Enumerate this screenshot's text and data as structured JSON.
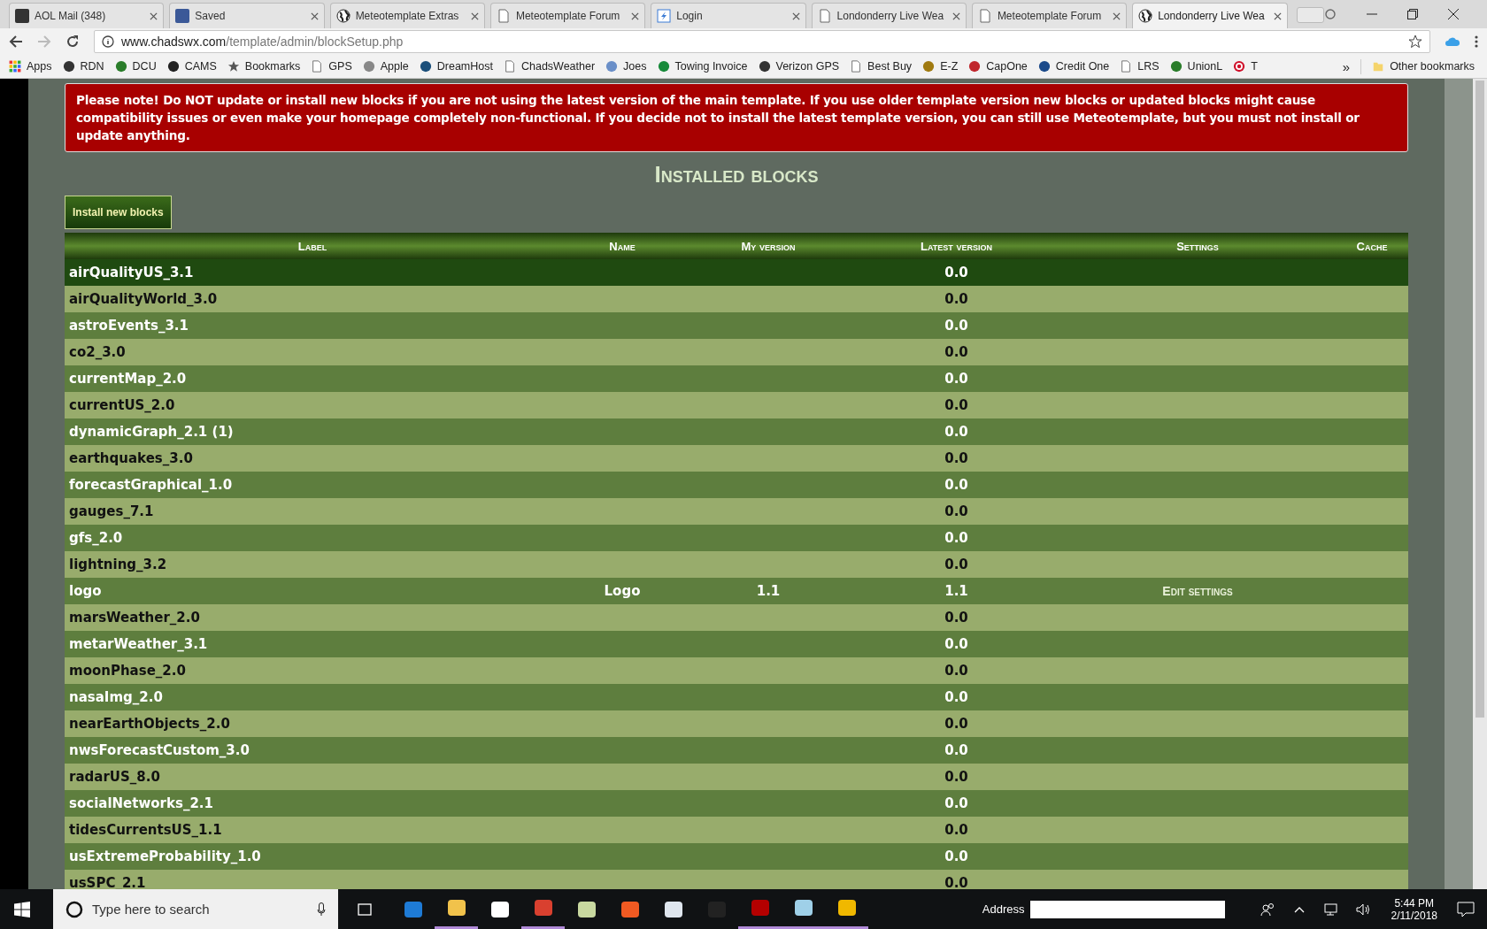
{
  "tabs": [
    {
      "title": "AOL Mail (348)",
      "kind": "aol",
      "selected": false
    },
    {
      "title": "Saved",
      "kind": "facebook",
      "selected": false
    },
    {
      "title": "Meteotemplate Extras",
      "kind": "globe",
      "selected": false
    },
    {
      "title": "Meteotemplate Forum",
      "kind": "page",
      "selected": false
    },
    {
      "title": "Login",
      "kind": "login",
      "selected": false
    },
    {
      "title": "Londonderry Live Wea",
      "kind": "page",
      "selected": false
    },
    {
      "title": "Meteotemplate Forum",
      "kind": "page",
      "selected": false
    },
    {
      "title": "Londonderry Live Wea",
      "kind": "globe",
      "selected": true
    }
  ],
  "address": {
    "host": "www.chadswx.com",
    "path": "/template/admin/blockSetup.php"
  },
  "bookmarks": [
    {
      "label": "Apps",
      "kind": "apps"
    },
    {
      "label": "RDN",
      "kind": "dark"
    },
    {
      "label": "DCU",
      "kind": "green"
    },
    {
      "label": "CAMS",
      "kind": "camera"
    },
    {
      "label": "Bookmarks",
      "kind": "star"
    },
    {
      "label": "GPS",
      "kind": "page"
    },
    {
      "label": "Apple",
      "kind": "apple"
    },
    {
      "label": "DreamHost",
      "kind": "moon"
    },
    {
      "label": "ChadsWeather",
      "kind": "page"
    },
    {
      "label": "Joes",
      "kind": "photo"
    },
    {
      "label": "Towing Invoice",
      "kind": "dollar"
    },
    {
      "label": "Verizon GPS",
      "kind": "dark"
    },
    {
      "label": "Best Buy",
      "kind": "page"
    },
    {
      "label": "E-Z",
      "kind": "badge"
    },
    {
      "label": "CapOne",
      "kind": "swoosh"
    },
    {
      "label": "Credit One",
      "kind": "blue"
    },
    {
      "label": "LRS",
      "kind": "page"
    },
    {
      "label": "UnionL",
      "kind": "green"
    },
    {
      "label": "T",
      "kind": "target"
    }
  ],
  "bookmarks_overflow": "»",
  "other_bookmarks": "Other bookmarks",
  "notice": "Please note! Do NOT update or install new blocks if you are not using the latest version of the main template. If you use older template version new blocks or updated blocks might cause compatibility issues or even make your homepage completely non-functional. If you decide not to install the latest template version, you can still use Meteotemplate, but you must not install or update anything.",
  "heading": "Installed blocks",
  "install_button": "Install new blocks",
  "table": {
    "columns": [
      "Label",
      "Name",
      "My version",
      "Latest version",
      "Settings",
      "Cache"
    ],
    "rows": [
      {
        "label": "airQualityUS_3.1",
        "latest": "0.0",
        "highlighted": true
      },
      {
        "label": "airQualityWorld_3.0",
        "latest": "0.0",
        "highlighted": false
      },
      {
        "label": "astroEvents_3.1",
        "latest": "0.0",
        "highlighted": false
      },
      {
        "label": "co2_3.0",
        "latest": "0.0",
        "highlighted": false
      },
      {
        "label": "currentMap_2.0",
        "latest": "0.0",
        "highlighted": false
      },
      {
        "label": "currentUS_2.0",
        "latest": "0.0",
        "highlighted": false
      },
      {
        "label": "dynamicGraph_2.1 (1)",
        "latest": "0.0",
        "highlighted": false
      },
      {
        "label": "earthquakes_3.0",
        "latest": "0.0",
        "highlighted": false
      },
      {
        "label": "forecastGraphical_1.0",
        "latest": "0.0",
        "highlighted": false
      },
      {
        "label": "gauges_7.1",
        "latest": "0.0",
        "highlighted": false
      },
      {
        "label": "gfs_2.0",
        "latest": "0.0",
        "highlighted": false
      },
      {
        "label": "lightning_3.2",
        "latest": "0.0",
        "highlighted": false
      },
      {
        "label": "logo",
        "name": "Logo",
        "mine": "1.1",
        "latest": "1.1",
        "settings": "Edit settings",
        "highlighted": false
      },
      {
        "label": "marsWeather_2.0",
        "latest": "0.0",
        "highlighted": false
      },
      {
        "label": "metarWeather_3.1",
        "latest": "0.0",
        "highlighted": false
      },
      {
        "label": "moonPhase_2.0",
        "latest": "0.0",
        "highlighted": false
      },
      {
        "label": "nasaImg_2.0",
        "latest": "0.0",
        "highlighted": false
      },
      {
        "label": "nearEarthObjects_2.0",
        "latest": "0.0",
        "highlighted": false
      },
      {
        "label": "nwsForecastCustom_3.0",
        "latest": "0.0",
        "highlighted": false
      },
      {
        "label": "radarUS_8.0",
        "latest": "0.0",
        "highlighted": false
      },
      {
        "label": "socialNetworks_2.1",
        "latest": "0.0",
        "highlighted": false
      },
      {
        "label": "tidesCurrentsUS_1.1",
        "latest": "0.0",
        "highlighted": false
      },
      {
        "label": "usExtremeProbability_1.0",
        "latest": "0.0",
        "highlighted": false
      },
      {
        "label": "usSPC_2.1",
        "latest": "0.0",
        "highlighted": false
      }
    ]
  },
  "taskbar": {
    "search_placeholder": "Type here to search",
    "apps": [
      {
        "kind": "edge",
        "active": false
      },
      {
        "kind": "folder",
        "active": true
      },
      {
        "kind": "store",
        "active": false
      },
      {
        "kind": "chrome",
        "active": true
      },
      {
        "kind": "mail",
        "active": false
      },
      {
        "kind": "origin",
        "active": false
      },
      {
        "kind": "helmet",
        "active": false
      },
      {
        "kind": "badge",
        "active": false
      },
      {
        "kind": "filezilla",
        "active": true
      },
      {
        "kind": "notepad",
        "active": true
      },
      {
        "kind": "clock",
        "active": true
      }
    ],
    "address_label": "Address",
    "time": "5:44 PM",
    "date": "2/11/2018"
  }
}
